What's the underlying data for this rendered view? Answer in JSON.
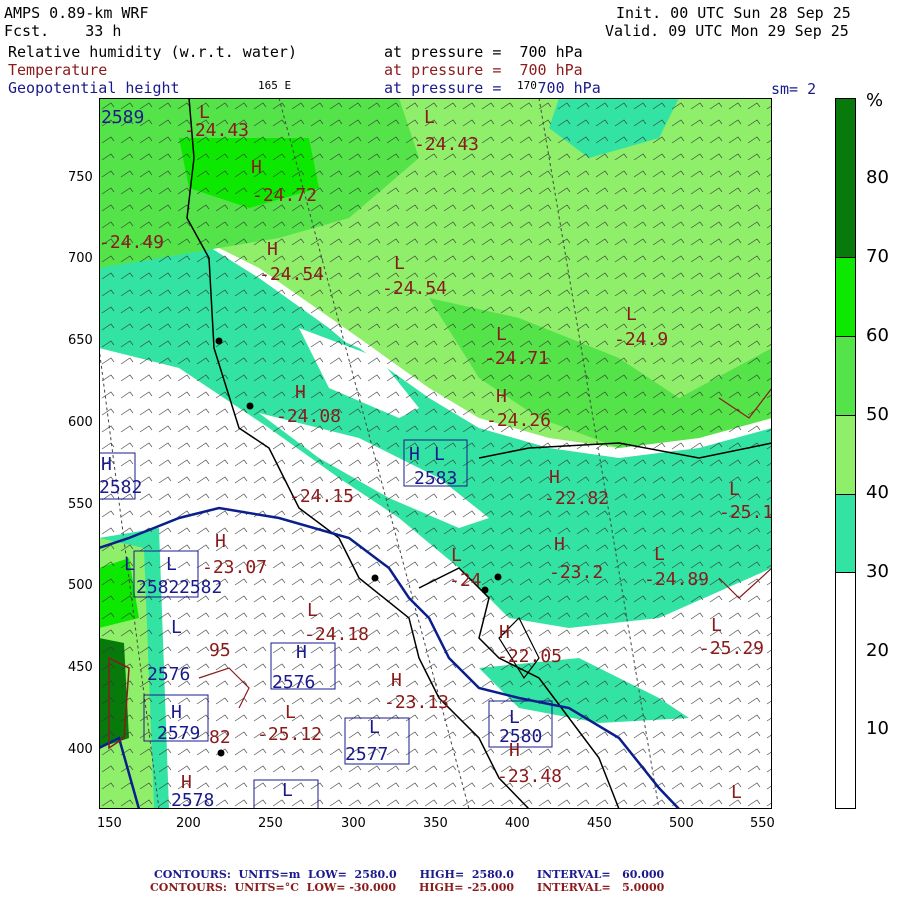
{
  "header": {
    "model": "AMPS 0.89-km WRF",
    "forecast": "Fcst.    33 h",
    "init": "Init. 00 UTC Sun 28 Sep 25",
    "valid": "Valid. 09 UTC Mon 29 Sep 25",
    "field1": "Relative humidity (w.r.t. water)",
    "field2": "Temperature",
    "field3": "Geopotential height",
    "level1": "at pressure =  700 hPa",
    "level2": "at pressure =  700 hPa",
    "level3": "at pressure =    700 hPa",
    "meridian1": "165 E",
    "meridian2": "170",
    "smoothing": "sm= 2"
  },
  "axes": {
    "x_ticks": [
      "150",
      "200",
      "250",
      "300",
      "350",
      "400",
      "450",
      "500",
      "550"
    ],
    "y_ticks": [
      "750",
      "700",
      "650",
      "600",
      "550",
      "500",
      "450",
      "400"
    ]
  },
  "colorbar": {
    "unit": "%",
    "labels": [
      "80",
      "70",
      "60",
      "50",
      "40",
      "30",
      "20",
      "10"
    ],
    "levels": [
      {
        "from": 0,
        "to": 30,
        "color": "#ffffff"
      },
      {
        "from": 30,
        "to": 40,
        "color": "#33e3a4"
      },
      {
        "from": 40,
        "to": 50,
        "color": "#8fef6b"
      },
      {
        "from": 50,
        "to": 60,
        "color": "#55e34a"
      },
      {
        "from": 60,
        "to": 70,
        "color": "#0de800"
      },
      {
        "from": 70,
        "to": 90,
        "color": "#087a0b"
      }
    ]
  },
  "map_labels": {
    "t": [
      {
        "text": "-24.43",
        "cls": "red"
      },
      {
        "text": "-24.43",
        "cls": "red"
      },
      {
        "text": "-24.72",
        "cls": "red"
      },
      {
        "text": "-24.49",
        "cls": "red"
      },
      {
        "text": "-24.54",
        "cls": "red"
      },
      {
        "text": "-24.54",
        "cls": "red"
      },
      {
        "text": "-24.9",
        "cls": "red"
      },
      {
        "text": "-24.71",
        "cls": "red"
      },
      {
        "text": "-24.08",
        "cls": "red"
      },
      {
        "text": "-24.26",
        "cls": "red"
      },
      {
        "text": "-24.15",
        "cls": "red"
      },
      {
        "text": "-22.82",
        "cls": "red"
      },
      {
        "text": "-25.1",
        "cls": "red"
      },
      {
        "text": "-23.07",
        "cls": "red"
      },
      {
        "text": "-24",
        "cls": "red"
      },
      {
        "text": "-23.2",
        "cls": "red"
      },
      {
        "text": "-24.89",
        "cls": "red"
      },
      {
        "text": "-24.18",
        "cls": "red"
      },
      {
        "text": "-22.05",
        "cls": "red"
      },
      {
        "text": "-25.29",
        "cls": "red"
      },
      {
        "text": "-23.13",
        "cls": "red"
      },
      {
        "text": "-25.12",
        "cls": "red"
      },
      {
        "text": "-23.48",
        "cls": "red"
      },
      {
        "text": "95",
        "cls": "red"
      },
      {
        "text": "82",
        "cls": "red"
      }
    ],
    "hl": [
      "L",
      "L",
      "H",
      "H",
      "L",
      "L",
      "L",
      "H",
      "H",
      "H",
      "H",
      "L",
      "H",
      "L",
      "H",
      "L",
      "L",
      "L",
      "L",
      "H",
      "L",
      "H",
      "L",
      "L",
      "H",
      "H",
      "L",
      "H",
      "H",
      "L",
      "L",
      "H",
      "L",
      "L"
    ],
    "z": [
      {
        "text": "2589"
      },
      {
        "text": "2583"
      },
      {
        "text": "2582"
      },
      {
        "text": "2582"
      },
      {
        "text": "2576"
      },
      {
        "text": "2576"
      },
      {
        "text": "2579"
      },
      {
        "text": "2577"
      },
      {
        "text": "2580"
      },
      {
        "text": "2578"
      },
      {
        "text": "2582"
      }
    ]
  },
  "footer": {
    "line1": "CONTOURS:  UNITS=m  LOW=  2580.0      HIGH=  2580.0      INTERVAL=   60.000",
    "line2": "CONTOURS:  UNITS=°C  LOW= -30.000      HIGH= -25.000      INTERVAL=   5.0000"
  }
}
